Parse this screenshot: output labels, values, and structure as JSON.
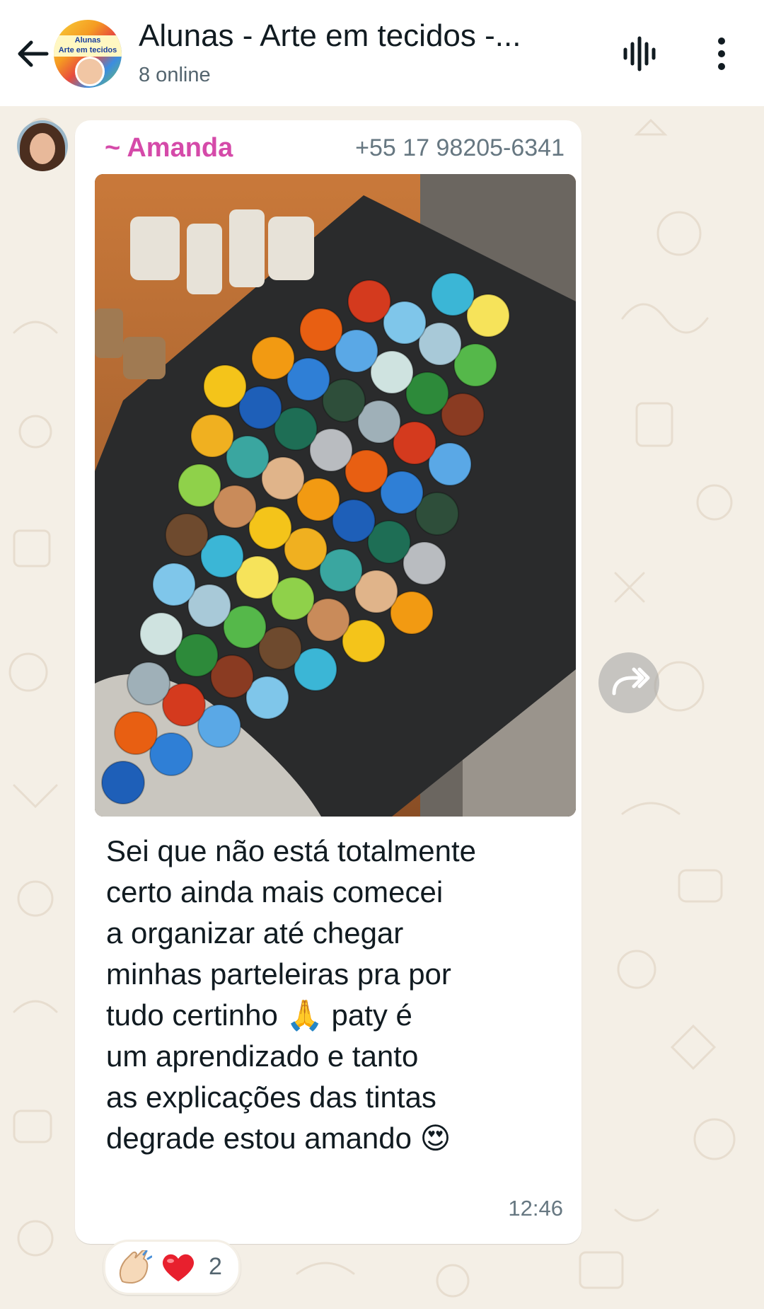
{
  "header": {
    "title": "Alunas - Arte em tecidos -...",
    "status": "8 online",
    "avatar_text": "Alunas\nArte em tecidos"
  },
  "message": {
    "sender_name": "~ Amanda",
    "sender_phone": "+55 17 98205-6341",
    "text_before_emoji1": "Sei que não está totalmente\ncerto ainda mais comecei\na organizar até chegar\nminhas parteleiras pra por\ntudo certinho ",
    "emoji1": "🙏",
    "text_between": " paty é\num aprendizado e tanto\nas explicações das tintas\ndegrade estou amando ",
    "emoji2": "😍",
    "time": "12:46"
  },
  "reactions": {
    "clap": "clap-emoji",
    "heart": "heart-emoji",
    "count": "2"
  },
  "colors": {
    "header_bg": "#ffffff",
    "chat_bg": "#f4efe6",
    "sender_name": "#d54aa9",
    "meta_text": "#667781"
  }
}
